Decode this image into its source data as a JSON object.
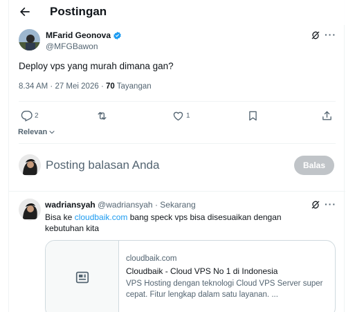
{
  "header": {
    "title": "Postingan"
  },
  "tweet": {
    "author_name": "MFarid Geonova",
    "author_handle": "@MFGBawon",
    "text": "Deploy vps yang murah dimana gan?",
    "time": "8.34 AM",
    "date": "27 Mei 2026",
    "views_count": "70",
    "views_label": "Tayangan",
    "actions": {
      "replies": "2",
      "retweets": "",
      "likes": "1"
    }
  },
  "sort": {
    "label": "Relevan"
  },
  "composer": {
    "placeholder": "Posting balasan Anda",
    "button_label": "Balas"
  },
  "reply": {
    "author_name": "wadriansyah",
    "author_handle": "@wadriansyah",
    "time": "Sekarang",
    "text_before": "Bisa ke ",
    "link_text": "cloudbaik.com",
    "text_after": " bang speck vps  bisa disesuaikan dengan kebutuhan kita",
    "card": {
      "domain": "cloudbaik.com",
      "title": "Cloudbaik - Cloud VPS No 1 di Indonesia",
      "description": "VPS Hosting dengan teknologi Cloud VPS Server super cepat. Fitur lengkap dalam satu layanan. ..."
    }
  },
  "colors": {
    "accent": "#1d9bf0",
    "text": "#0f1419",
    "muted": "#536471",
    "border": "#eff3f4"
  },
  "icons": [
    "back-arrow-icon",
    "verified-badge-icon",
    "grok-icon",
    "more-icon",
    "reply-icon",
    "retweet-icon",
    "like-icon",
    "bookmark-icon",
    "share-icon",
    "chevron-down-icon",
    "article-icon"
  ]
}
